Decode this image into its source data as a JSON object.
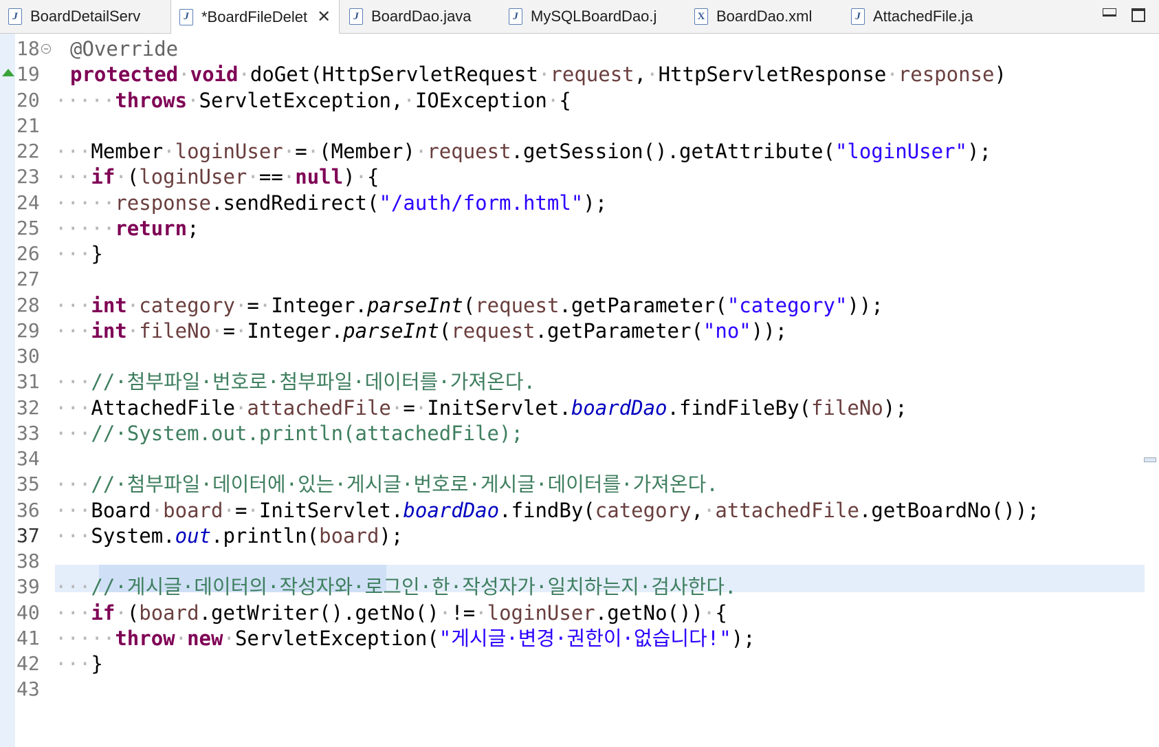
{
  "tabs": [
    {
      "label": "BoardDetailServ",
      "icon": "java-file-icon"
    },
    {
      "label": "*BoardFileDelet",
      "icon": "java-file-icon",
      "active": true
    },
    {
      "label": "BoardDao.java",
      "icon": "java-file-icon"
    },
    {
      "label": "MySQLBoardDao.j",
      "icon": "java-file-icon"
    },
    {
      "label": "BoardDao.xml",
      "icon": "xml-file-icon"
    },
    {
      "label": "AttachedFile.ja",
      "icon": "java-file-icon"
    }
  ],
  "editor": {
    "current_line": 37,
    "lines": [
      {
        "n": "18",
        "code": [
          [
            "a",
            "@Override"
          ]
        ]
      },
      {
        "n": "19",
        "code": [
          [
            "k",
            "protected"
          ],
          [
            "dot",
            "·"
          ],
          [
            "k",
            "void"
          ],
          [
            "dot",
            "·"
          ],
          [
            "p",
            "doGet(HttpServletRequest"
          ],
          [
            "dot",
            "·"
          ],
          [
            "v",
            "request"
          ],
          [
            "p",
            ","
          ],
          [
            "dot",
            "·"
          ],
          [
            "p",
            "HttpServletResponse"
          ],
          [
            "dot",
            "·"
          ],
          [
            "v",
            "response"
          ],
          [
            "p",
            ")"
          ]
        ]
      },
      {
        "n": "20",
        "code": [
          [
            "dot",
            "·····"
          ],
          [
            "k",
            "throws"
          ],
          [
            "dot",
            "·"
          ],
          [
            "p",
            "ServletException,"
          ],
          [
            "dot",
            "·"
          ],
          [
            "p",
            "IOException"
          ],
          [
            "dot",
            "·"
          ],
          [
            "p",
            "{"
          ]
        ]
      },
      {
        "n": "21",
        "code": []
      },
      {
        "n": "22",
        "code": [
          [
            "dot",
            "···"
          ],
          [
            "p",
            "Member"
          ],
          [
            "dot",
            "·"
          ],
          [
            "v",
            "loginUser"
          ],
          [
            "dot",
            "·"
          ],
          [
            "p",
            "="
          ],
          [
            "dot",
            "·"
          ],
          [
            "p",
            "(Member)"
          ],
          [
            "dot",
            "·"
          ],
          [
            "v",
            "request"
          ],
          [
            "p",
            ".getSession().getAttribute("
          ],
          [
            "s",
            "\"loginUser\""
          ],
          [
            "p",
            ");"
          ]
        ]
      },
      {
        "n": "23",
        "code": [
          [
            "dot",
            "···"
          ],
          [
            "k",
            "if"
          ],
          [
            "dot",
            "·"
          ],
          [
            "p",
            "("
          ],
          [
            "v",
            "loginUser"
          ],
          [
            "dot",
            "·"
          ],
          [
            "p",
            "=="
          ],
          [
            "dot",
            "·"
          ],
          [
            "k",
            "null"
          ],
          [
            "p",
            ")"
          ],
          [
            "dot",
            "·"
          ],
          [
            "p",
            "{"
          ]
        ]
      },
      {
        "n": "24",
        "code": [
          [
            "dot",
            "·····"
          ],
          [
            "v",
            "response"
          ],
          [
            "p",
            ".sendRedirect("
          ],
          [
            "s",
            "\"/auth/form.html\""
          ],
          [
            "p",
            ");"
          ]
        ]
      },
      {
        "n": "25",
        "code": [
          [
            "dot",
            "·····"
          ],
          [
            "k",
            "return"
          ],
          [
            "p",
            ";"
          ]
        ]
      },
      {
        "n": "26",
        "code": [
          [
            "dot",
            "···"
          ],
          [
            "p",
            "}"
          ]
        ]
      },
      {
        "n": "27",
        "code": []
      },
      {
        "n": "28",
        "code": [
          [
            "dot",
            "···"
          ],
          [
            "k",
            "int"
          ],
          [
            "dot",
            "·"
          ],
          [
            "v",
            "category"
          ],
          [
            "dot",
            "·"
          ],
          [
            "p",
            "="
          ],
          [
            "dot",
            "·"
          ],
          [
            "p",
            "Integer."
          ],
          [
            "m",
            "parseInt"
          ],
          [
            "p",
            "("
          ],
          [
            "v",
            "request"
          ],
          [
            "p",
            ".getParameter("
          ],
          [
            "s",
            "\"category\""
          ],
          [
            "p",
            "));"
          ]
        ]
      },
      {
        "n": "29",
        "code": [
          [
            "dot",
            "···"
          ],
          [
            "k",
            "int"
          ],
          [
            "dot",
            "·"
          ],
          [
            "v",
            "fileNo"
          ],
          [
            "dot",
            "·"
          ],
          [
            "p",
            "="
          ],
          [
            "dot",
            "·"
          ],
          [
            "p",
            "Integer."
          ],
          [
            "m",
            "parseInt"
          ],
          [
            "p",
            "("
          ],
          [
            "v",
            "request"
          ],
          [
            "p",
            ".getParameter("
          ],
          [
            "s",
            "\"no\""
          ],
          [
            "p",
            "));"
          ]
        ]
      },
      {
        "n": "30",
        "code": []
      },
      {
        "n": "31",
        "code": [
          [
            "dot",
            "···"
          ],
          [
            "c",
            "//·첨부파일·번호로·첨부파일·데이터를·가져온다."
          ]
        ]
      },
      {
        "n": "32",
        "code": [
          [
            "dot",
            "···"
          ],
          [
            "p",
            "AttachedFile"
          ],
          [
            "dot",
            "·"
          ],
          [
            "v",
            "attachedFile"
          ],
          [
            "dot",
            "·"
          ],
          [
            "p",
            "="
          ],
          [
            "dot",
            "·"
          ],
          [
            "p",
            "InitServlet."
          ],
          [
            "f",
            "boardDao"
          ],
          [
            "p",
            ".findFileBy("
          ],
          [
            "v",
            "fileNo"
          ],
          [
            "p",
            ");"
          ]
        ]
      },
      {
        "n": "33",
        "code": [
          [
            "dot",
            "···"
          ],
          [
            "c",
            "//·System.out.println(attachedFile);"
          ]
        ]
      },
      {
        "n": "34",
        "code": []
      },
      {
        "n": "35",
        "code": [
          [
            "dot",
            "···"
          ],
          [
            "c",
            "//·첨부파일·데이터에·있는·게시글·번호로·게시글·데이터를·가져온다."
          ]
        ]
      },
      {
        "n": "36",
        "code": [
          [
            "dot",
            "···"
          ],
          [
            "p",
            "Board"
          ],
          [
            "dot",
            "·"
          ],
          [
            "v",
            "board"
          ],
          [
            "dot",
            "·"
          ],
          [
            "p",
            "="
          ],
          [
            "dot",
            "·"
          ],
          [
            "p",
            "InitServlet."
          ],
          [
            "f",
            "boardDao"
          ],
          [
            "p",
            ".findBy("
          ],
          [
            "v",
            "category"
          ],
          [
            "p",
            ","
          ],
          [
            "dot",
            "·"
          ],
          [
            "v",
            "attachedFile"
          ],
          [
            "p",
            ".getBoardNo());"
          ]
        ]
      },
      {
        "n": "37",
        "code": [
          [
            "dot",
            "···"
          ],
          [
            "p",
            "System."
          ],
          [
            "f",
            "out"
          ],
          [
            "p",
            ".println("
          ],
          [
            "v",
            "board"
          ],
          [
            "p",
            ");"
          ]
        ]
      },
      {
        "n": "38",
        "code": []
      },
      {
        "n": "39",
        "code": [
          [
            "dot",
            "···"
          ],
          [
            "c",
            "//·게시글·데이터의·작성자와·로그인·한·작성자가·일치하는지·검사한다."
          ]
        ]
      },
      {
        "n": "40",
        "code": [
          [
            "dot",
            "···"
          ],
          [
            "k",
            "if"
          ],
          [
            "dot",
            "·"
          ],
          [
            "p",
            "("
          ],
          [
            "v",
            "board"
          ],
          [
            "p",
            ".getWriter().getNo()"
          ],
          [
            "dot",
            "·"
          ],
          [
            "p",
            "!="
          ],
          [
            "dot",
            "·"
          ],
          [
            "v",
            "loginUser"
          ],
          [
            "p",
            ".getNo())"
          ],
          [
            "dot",
            "·"
          ],
          [
            "p",
            "{"
          ]
        ]
      },
      {
        "n": "41",
        "code": [
          [
            "dot",
            "·····"
          ],
          [
            "k",
            "throw"
          ],
          [
            "dot",
            "·"
          ],
          [
            "k",
            "new"
          ],
          [
            "dot",
            "·"
          ],
          [
            "p",
            "ServletException("
          ],
          [
            "s",
            "\"게시글·변경·권한이·없습니다!\""
          ],
          [
            "p",
            ");"
          ]
        ]
      },
      {
        "n": "42",
        "code": [
          [
            "dot",
            "···"
          ],
          [
            "p",
            "}"
          ]
        ]
      },
      {
        "n": "43",
        "code": []
      }
    ]
  }
}
